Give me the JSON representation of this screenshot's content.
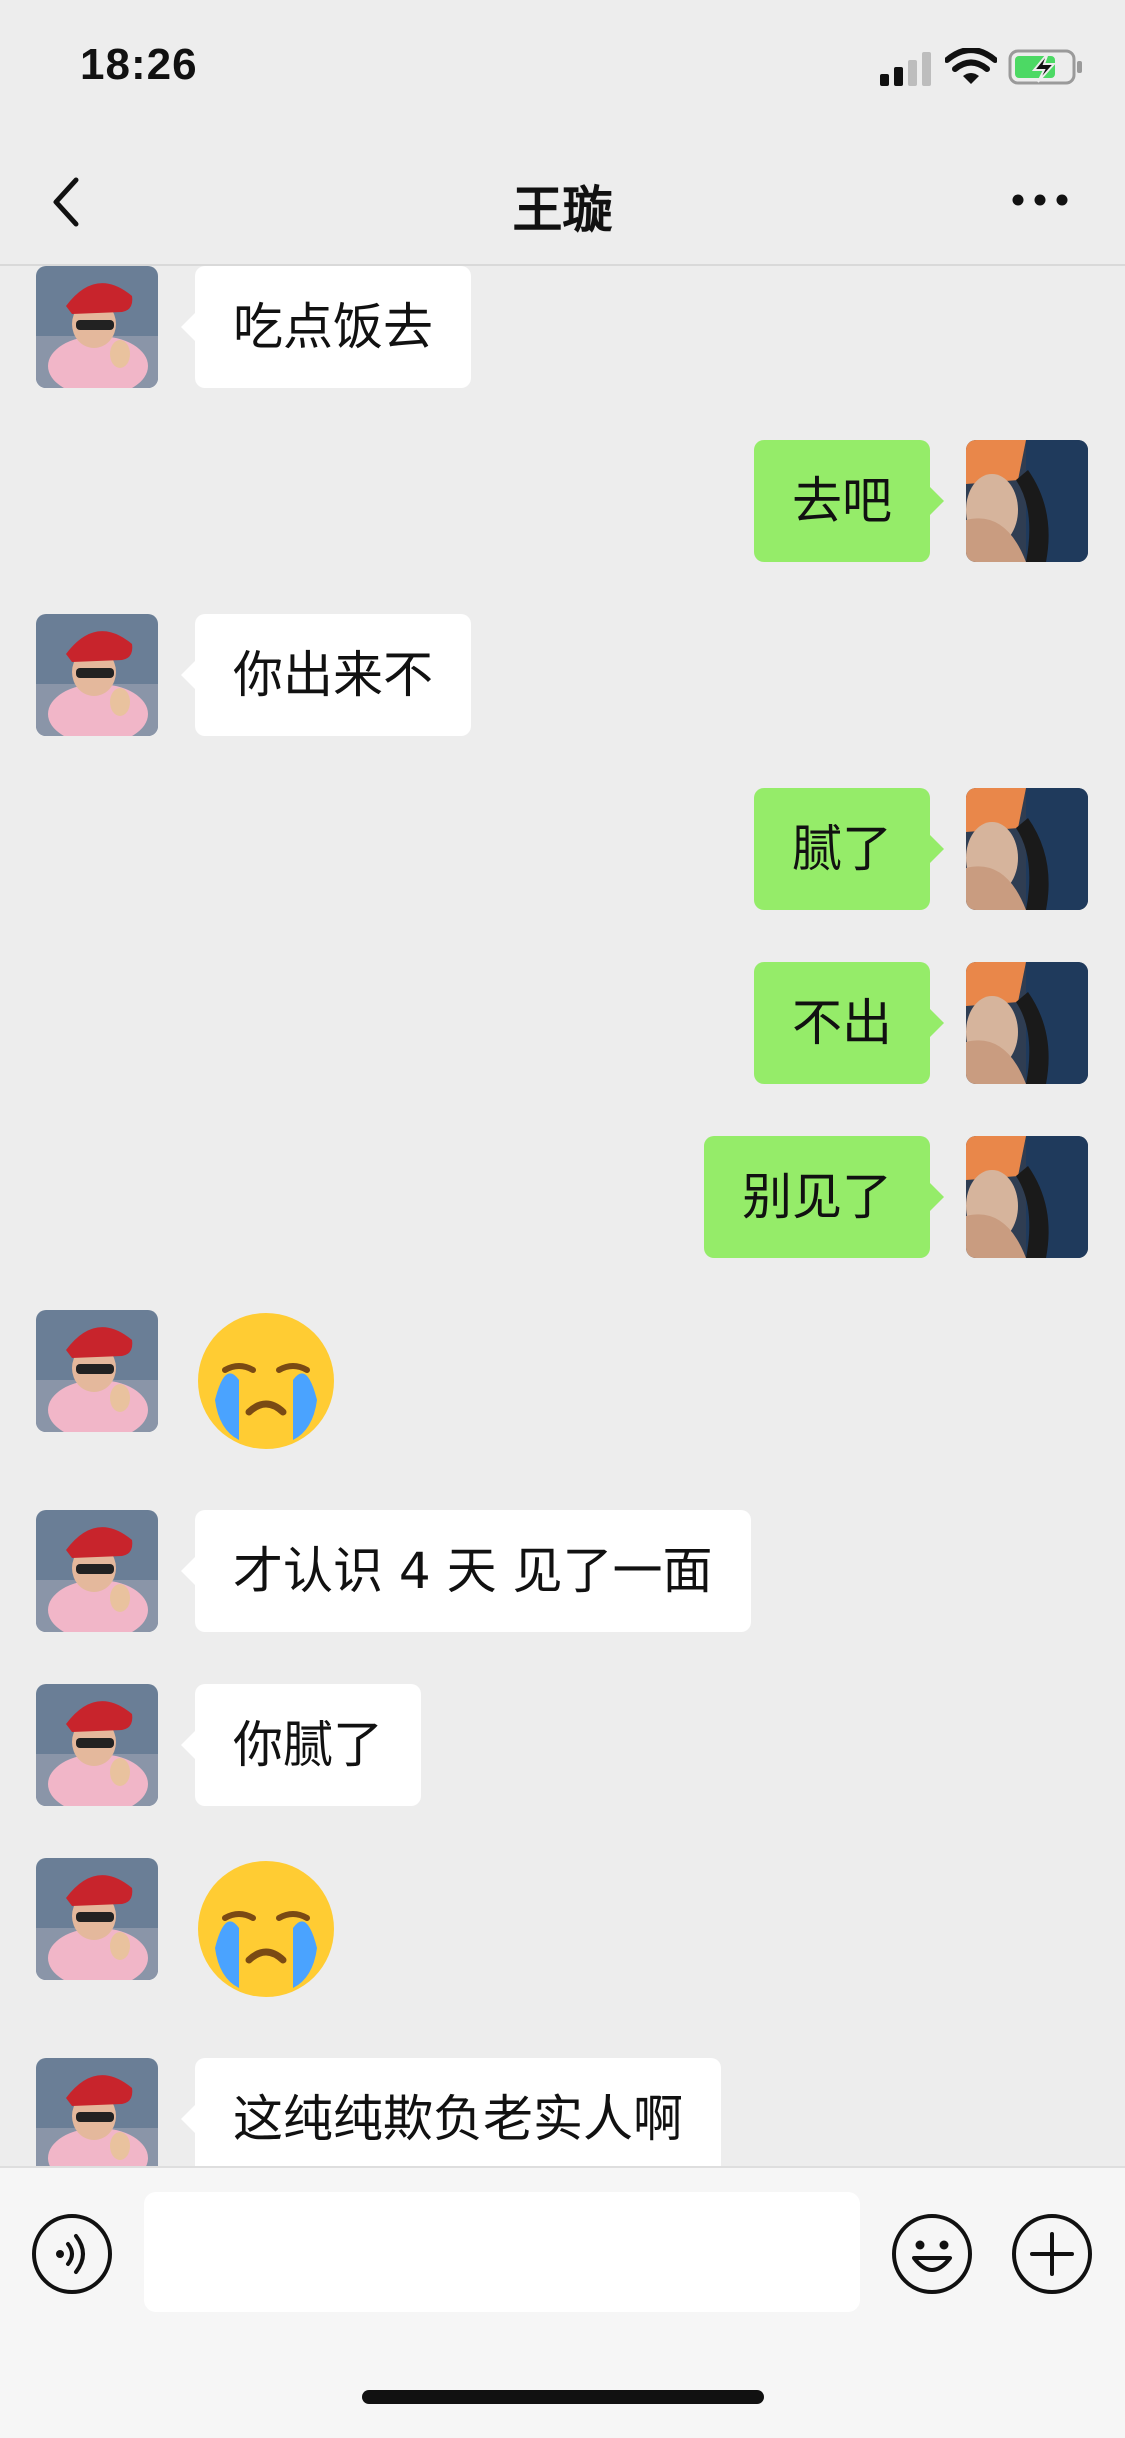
{
  "status_bar": {
    "time": "18:26"
  },
  "header": {
    "title": "王璇",
    "back_icon": "chevron-left-icon",
    "more_icon": "more-dots-icon"
  },
  "messages": [
    {
      "side": "left",
      "type": "text",
      "text": "吃点饭去"
    },
    {
      "side": "right",
      "type": "text",
      "text": "去吧"
    },
    {
      "side": "left",
      "type": "text",
      "text": "你出来不"
    },
    {
      "side": "right",
      "type": "text",
      "text": "腻了"
    },
    {
      "side": "right",
      "type": "text",
      "text": "不出"
    },
    {
      "side": "right",
      "type": "text",
      "text": "别见了"
    },
    {
      "side": "left",
      "type": "emoji",
      "emoji": "crying-face-emoji"
    },
    {
      "side": "left",
      "type": "text",
      "text": "才认识 4 天 见了一面"
    },
    {
      "side": "left",
      "type": "text",
      "text": "你腻了"
    },
    {
      "side": "left",
      "type": "emoji",
      "emoji": "crying-face-emoji"
    },
    {
      "side": "left",
      "type": "text",
      "text": "这纯纯欺负老实人啊"
    }
  ],
  "input_bar": {
    "placeholder": "",
    "voice_icon": "voice-icon",
    "emoji_icon": "emoji-icon",
    "plus_icon": "plus-icon"
  },
  "colors": {
    "background": "#ededed",
    "bubble_self": "#95ec69",
    "bubble_other": "#ffffff",
    "battery_charging": "#4cd964"
  }
}
